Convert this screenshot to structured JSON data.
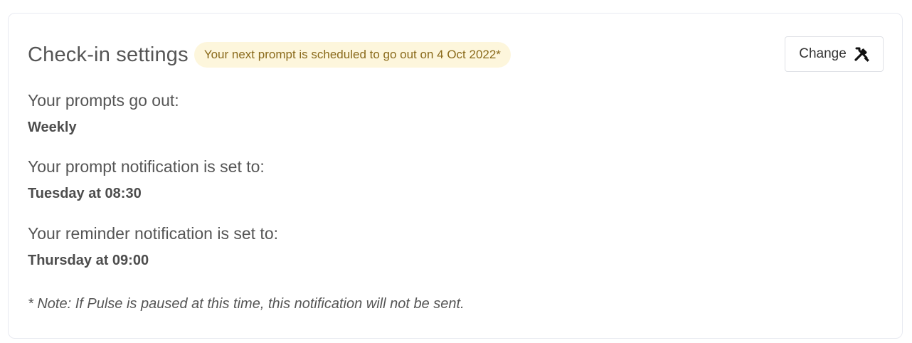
{
  "title": "Check-in settings",
  "badge": "Your next prompt is scheduled to go out on 4 Oct 2022*",
  "change_button": {
    "label": "Change",
    "icon": "tools-icon"
  },
  "settings": [
    {
      "label": "Your prompts go out:",
      "value": "Weekly"
    },
    {
      "label": "Your prompt notification is set to:",
      "value": "Tuesday at 08:30"
    },
    {
      "label": "Your reminder notification is set to:",
      "value": "Thursday at 09:00"
    }
  ],
  "note": "* Note: If Pulse is paused at this time, this notification will not be sent.",
  "colors": {
    "badge_bg": "#fdf6dc",
    "badge_text": "#8a6a1b",
    "card_border": "#e8eaf1"
  }
}
